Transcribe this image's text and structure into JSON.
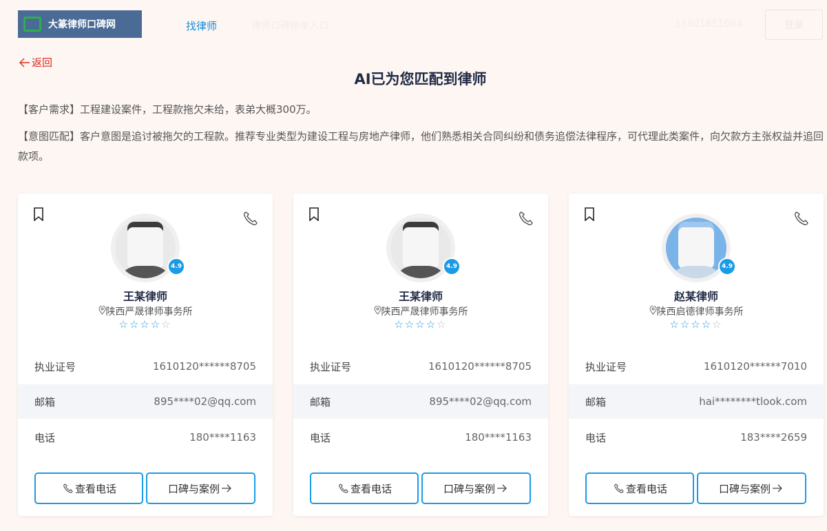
{
  "header": {
    "logo_text": "大篆律师口碑网",
    "nav_find": "找律师",
    "nav_faded": "律师口碑榜单入口",
    "phone_faded": "15801851064",
    "login_faded": "登录"
  },
  "back_label": "返回",
  "page_title": "AI已为您匹配到律师",
  "customer_need": "【客户需求】工程建设案件，工程款拖欠未给，表弟大概300万。",
  "intent_match": "【意图匹配】客户意图是追讨被拖欠的工程款。推荐专业类型为建设工程与房地产律师，他们熟悉相关合同纠纷和债务追偿法律程序，可代理此类案件，向欠款方主张权益并追回款项。",
  "labels": {
    "license": "执业证号",
    "email": "邮箱",
    "phone": "电话",
    "view_phone": "查看电话",
    "reputation": "口碑与案例"
  },
  "icons": {
    "bookmark": "bookmark-icon",
    "phone": "phone-icon",
    "location": "location-pin-icon",
    "arrow": "arrow-right-icon",
    "back": "arrow-left-icon"
  },
  "colors": {
    "accent": "#1a9be6",
    "back_red": "#e02a1f",
    "title": "#1f2a44",
    "logo_bg": "#4a6b96"
  },
  "lawyers": [
    {
      "name": "王某律师",
      "firm": "陕西严晟律师事务所",
      "rating": "4.9",
      "stars": "4/5",
      "license": "1610120******8705",
      "email": "895****02@qq.com",
      "phone": "180****1163"
    },
    {
      "name": "王某律师",
      "firm": "陕西严晟律师事务所",
      "rating": "4.9",
      "stars": "4/5",
      "license": "1610120******8705",
      "email": "895****02@qq.com",
      "phone": "180****1163"
    },
    {
      "name": "赵某律师",
      "firm": "陕西启德律师事务所",
      "rating": "4.9",
      "stars": "4/5",
      "license": "1610120******7010",
      "email": "hai********tlook.com",
      "phone": "183****2659"
    }
  ]
}
